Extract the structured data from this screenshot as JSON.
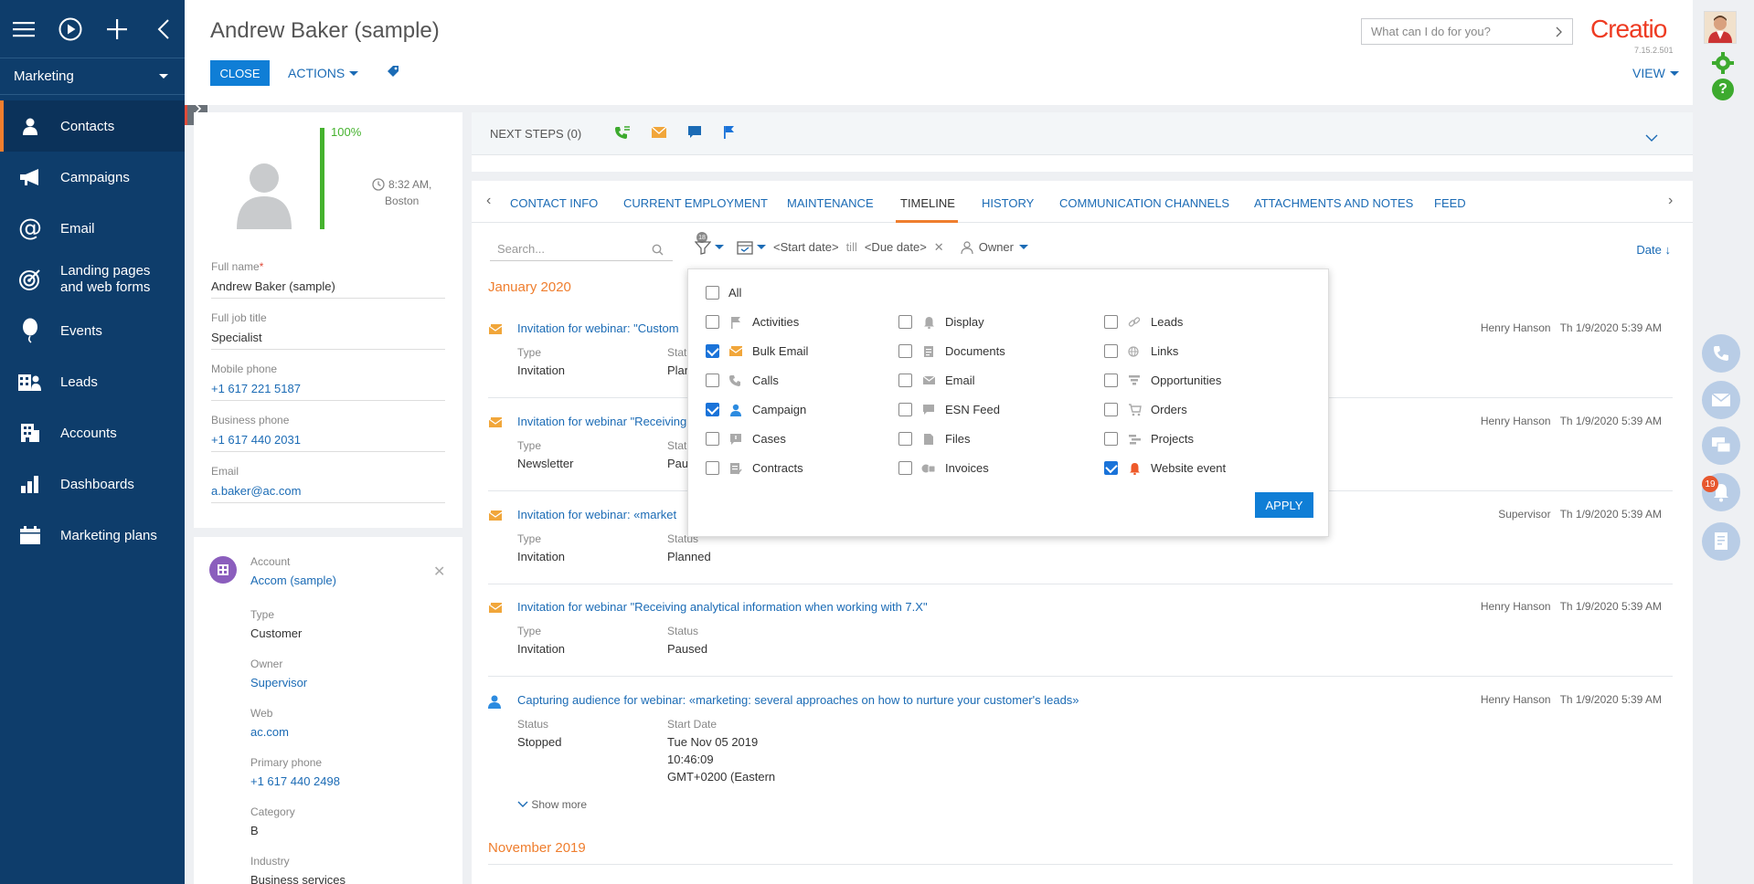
{
  "sidebar": {
    "workspace": "Marketing",
    "items": [
      {
        "label": "Contacts",
        "icon": "contact-icon"
      },
      {
        "label": "Campaigns",
        "icon": "megaphone-icon"
      },
      {
        "label": "Email",
        "icon": "at-icon"
      },
      {
        "label": "Landing pages and web forms",
        "line1": "Landing pages",
        "line2": "and web forms",
        "icon": "target-icon"
      },
      {
        "label": "Events",
        "icon": "balloon-icon"
      },
      {
        "label": "Leads",
        "icon": "leads-icon"
      },
      {
        "label": "Accounts",
        "icon": "building-icon"
      },
      {
        "label": "Dashboards",
        "icon": "bar-chart-icon"
      },
      {
        "label": "Marketing plans",
        "icon": "calendar-icon"
      }
    ]
  },
  "header": {
    "title": "Andrew Baker (sample)",
    "close_label": "CLOSE",
    "actions_label": "ACTIONS",
    "search_placeholder": "What can I do for you?",
    "logo": "Creatio",
    "version": "7.15.2.501",
    "view_label": "VIEW"
  },
  "profile": {
    "completeness": "100%",
    "local_time": "8:32 AM,",
    "local_city": "Boston",
    "fields": [
      {
        "label": "Full name",
        "value": "Andrew Baker (sample)",
        "required": "*"
      },
      {
        "label": "Full job title",
        "value": "Specialist"
      },
      {
        "label": "Mobile phone",
        "value": "+1 617 221 5187"
      },
      {
        "label": "Business phone",
        "value": "+1 617 440 2031"
      },
      {
        "label": "Email",
        "value": "a.baker@ac.com"
      }
    ]
  },
  "account": {
    "label": "Account",
    "name": "Accom (sample)",
    "fields": [
      {
        "label": "Type",
        "value": "Customer"
      },
      {
        "label": "Owner",
        "value": "Supervisor"
      },
      {
        "label": "Web",
        "value": "ac.com"
      },
      {
        "label": "Primary phone",
        "value": "+1 617 440 2498"
      },
      {
        "label": "Category",
        "value": "B"
      },
      {
        "label": "Industry",
        "value": "Business services"
      }
    ]
  },
  "next_steps": {
    "label": "NEXT STEPS (0)"
  },
  "tabs": [
    "CONTACT INFO",
    "CURRENT EMPLOYMENT",
    "MAINTENANCE",
    "TIMELINE",
    "HISTORY",
    "COMMUNICATION CHANNELS",
    "ATTACHMENTS AND NOTES",
    "FEED"
  ],
  "active_tab": "TIMELINE",
  "timeline": {
    "search_placeholder": "Search...",
    "filter_count": "18",
    "start_date": "<Start date>",
    "till": "till",
    "due_date": "<Due date>",
    "owner_label": "Owner",
    "sort_label": "Date",
    "months": [
      "January 2020",
      "November 2019"
    ],
    "items": [
      {
        "title": "Invitation for webinar: \"Custom",
        "owner": "Henry Hanson",
        "date": "Th 1/9/2020 5:39 AM",
        "c1_label": "Type",
        "c1_value": "Invitation",
        "c2_label": "Status",
        "c2_value": "Plann"
      },
      {
        "title": "Invitation for webinar \"Receiving",
        "owner": "Henry Hanson",
        "date": "Th 1/9/2020 5:39 AM",
        "c1_label": "Type",
        "c1_value": "Newsletter",
        "c2_label": "Stat",
        "c2_value": "Paus"
      },
      {
        "title": "Invitation for webinar: «market",
        "owner": "Supervisor",
        "date": "Th 1/9/2020 5:39 AM",
        "c1_label": "Type",
        "c1_value": "Invitation",
        "c2_label": "Status",
        "c2_value": "Planned"
      },
      {
        "title": "Invitation for webinar \"Receiving analytical information when working with 7.X\"",
        "owner": "Henry Hanson",
        "date": "Th 1/9/2020 5:39 AM",
        "c1_label": "Type",
        "c1_value": "Invitation",
        "c2_label": "Status",
        "c2_value": "Paused"
      },
      {
        "title": "Capturing audience for webinar: «marketing: several approaches on how to nurture your customer's leads»",
        "owner": "Henry Hanson",
        "date": "Th 1/9/2020 5:39 AM",
        "c1_label": "Status",
        "c1_value": "Stopped",
        "c2_label": "Start Date",
        "c2_line1": "Tue Nov 05 2019",
        "c2_line2": "10:46:09",
        "c2_line3": "GMT+0200 (Eastern"
      }
    ],
    "show_more": "Show more"
  },
  "filter_popup": {
    "all_label": "All",
    "apply_label": "APPLY",
    "options": [
      {
        "label": "Activities",
        "checked": false,
        "icon": "flag-icon"
      },
      {
        "label": "Bulk Email",
        "checked": true,
        "icon": "bulk-email-icon"
      },
      {
        "label": "Calls",
        "checked": false,
        "icon": "phone-icon"
      },
      {
        "label": "Campaign",
        "checked": true,
        "icon": "campaign-person-icon"
      },
      {
        "label": "Cases",
        "checked": false,
        "icon": "case-icon"
      },
      {
        "label": "Contracts",
        "checked": false,
        "icon": "contract-icon"
      },
      {
        "label": "Display",
        "checked": false,
        "icon": "bell-icon"
      },
      {
        "label": "Documents",
        "checked": false,
        "icon": "document-icon"
      },
      {
        "label": "Email",
        "checked": false,
        "icon": "envelope-icon"
      },
      {
        "label": "ESN Feed",
        "checked": false,
        "icon": "chat-icon"
      },
      {
        "label": "Files",
        "checked": false,
        "icon": "file-icon"
      },
      {
        "label": "Invoices",
        "checked": false,
        "icon": "invoice-icon"
      },
      {
        "label": "Leads",
        "checked": false,
        "icon": "link-icon"
      },
      {
        "label": "Links",
        "checked": false,
        "icon": "globe-link-icon"
      },
      {
        "label": "Opportunities",
        "checked": false,
        "icon": "funnel-icon"
      },
      {
        "label": "Orders",
        "checked": false,
        "icon": "cart-icon"
      },
      {
        "label": "Projects",
        "checked": false,
        "icon": "project-icon"
      },
      {
        "label": "Website event",
        "checked": true,
        "icon": "bell-orange-icon"
      }
    ]
  },
  "rail": {
    "notification_count": "19"
  },
  "colors": {
    "sidebar": "#0e3d6b",
    "accent": "#ef7e2e",
    "primary_button": "#0f7ed6",
    "link": "#1b6bb5",
    "brand": "#ee3b22"
  }
}
